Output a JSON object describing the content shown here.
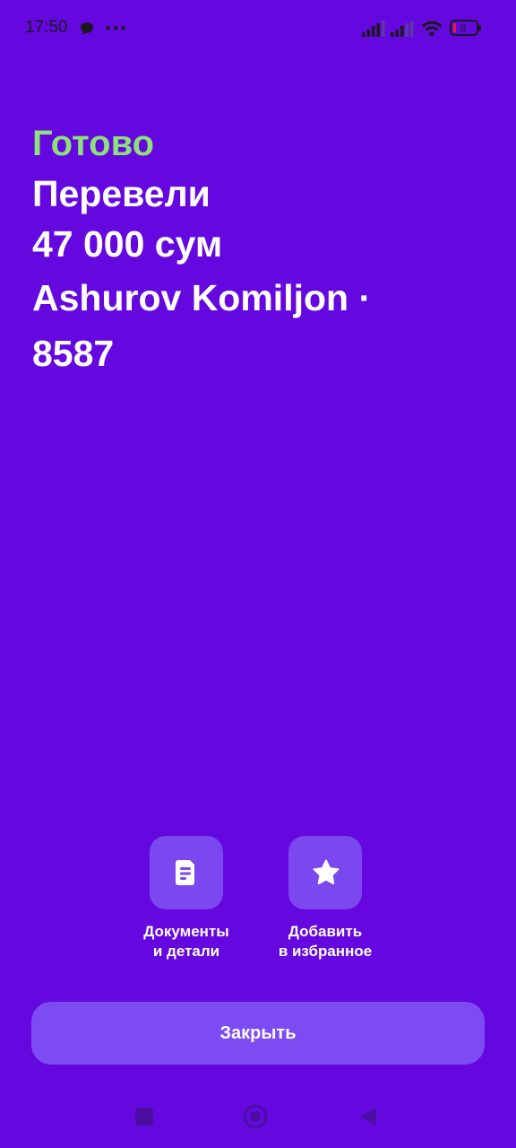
{
  "status_bar": {
    "time": "17:50",
    "battery": "8",
    "icons": [
      "chat-icon",
      "more-icon",
      "signal-icon",
      "signal-icon",
      "wifi-icon",
      "battery-icon"
    ]
  },
  "result": {
    "status": "Готово",
    "line1": "Перевели",
    "amount": "47 000 сум",
    "recipient_line1": "Ashurov Komiljon ·",
    "recipient_line2": "8587"
  },
  "actions": [
    {
      "label_line1": "Документы",
      "label_line2": "и детали",
      "icon": "document-icon"
    },
    {
      "label_line1": "Добавить",
      "label_line2": "в избранное",
      "icon": "star-icon"
    }
  ],
  "close_label": "Закрыть",
  "colors": {
    "background": "#6508E0",
    "accent_green": "#8EE07A",
    "tile": "#7A48EE",
    "button": "#7C4CF2"
  },
  "navbar": {
    "icons": [
      "recents-icon",
      "home-icon",
      "back-icon"
    ]
  }
}
